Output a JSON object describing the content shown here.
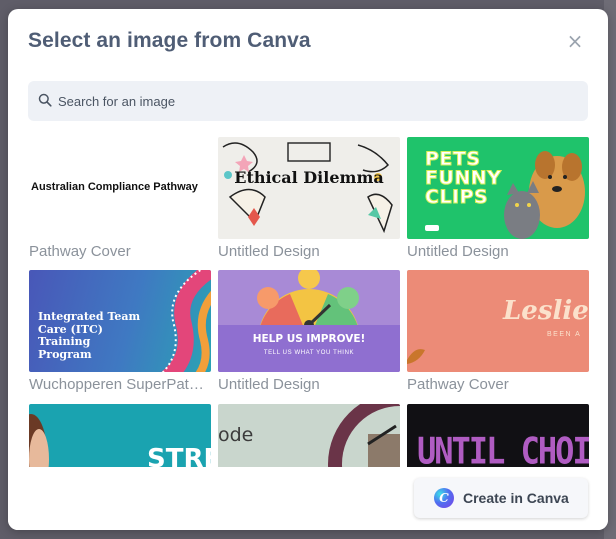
{
  "modal": {
    "title": "Select an image from Canva",
    "close_glyph": "×"
  },
  "search": {
    "placeholder": "Search for an image",
    "value": ""
  },
  "designs": [
    {
      "label": "Pathway Cover",
      "thumb_text": "Australian Compliance Pathway"
    },
    {
      "label": "Untitled Design",
      "thumb_text": "Ethical Dilemma"
    },
    {
      "label": "Untitled Design",
      "thumb_text": "PETS FUNNY CLIPS"
    },
    {
      "label": "Wuchopperen SuperPathway",
      "thumb_text": "Integrated Team Care (ITC) Training Program"
    },
    {
      "label": "Untitled Design",
      "thumb_text": "HELP US IMPROVE!",
      "thumb_subtext": "TELL US WHAT YOU THINK"
    },
    {
      "label": "Pathway Cover",
      "thumb_text": "Leslie A",
      "thumb_subtext": "BEEN A"
    },
    {
      "thumb_text": "STRE"
    },
    {
      "thumb_text": "ode"
    },
    {
      "thumb_text": "UNTIL CHOICE"
    }
  ],
  "footer": {
    "create_button_label": "Create in Canva",
    "logo_glyph": "C"
  },
  "icons": [
    "search-icon",
    "close-icon",
    "canva-logo-icon"
  ],
  "colors": {
    "title": "#4f5d75",
    "search_bg": "#eef1f6",
    "label": "#8b929b"
  }
}
